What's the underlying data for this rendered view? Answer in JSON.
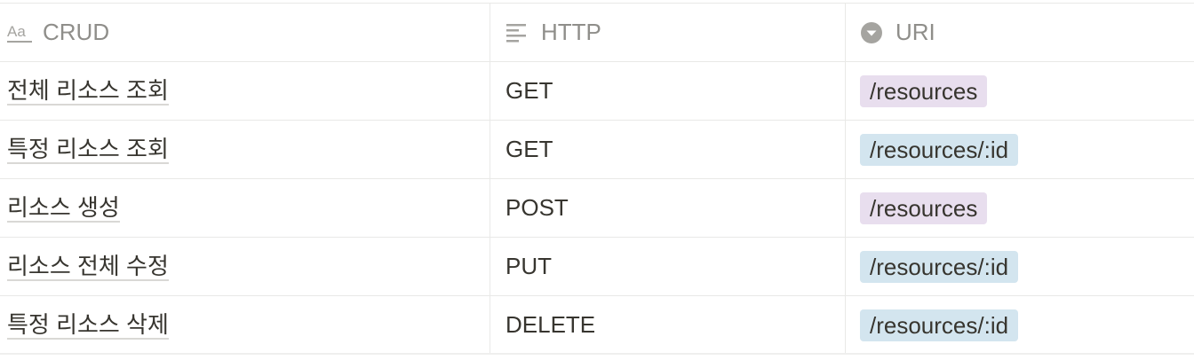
{
  "header": {
    "col1": {
      "label": "CRUD",
      "icon": "text-aa-icon"
    },
    "col2": {
      "label": "HTTP",
      "icon": "lines-icon"
    },
    "col3": {
      "label": "URI",
      "icon": "select-circle-icon"
    }
  },
  "colors": {
    "tag_purple": "#e8deee",
    "tag_blue": "#d3e5ef",
    "header_text": "#8f8e8a",
    "text": "#37352f"
  },
  "rows": [
    {
      "crud": "전체 리소스 조회",
      "http": "GET",
      "uri": "/resources",
      "uri_color": "purple"
    },
    {
      "crud": "특정 리소스 조회",
      "http": "GET",
      "uri": "/resources/:id",
      "uri_color": "blue"
    },
    {
      "crud": "리소스 생성",
      "http": "POST",
      "uri": "/resources",
      "uri_color": "purple"
    },
    {
      "crud": "리소스 전체 수정",
      "http": "PUT",
      "uri": "/resources/:id",
      "uri_color": "blue"
    },
    {
      "crud": "특정 리소스 삭제",
      "http": "DELETE",
      "uri": "/resources/:id",
      "uri_color": "blue"
    }
  ]
}
